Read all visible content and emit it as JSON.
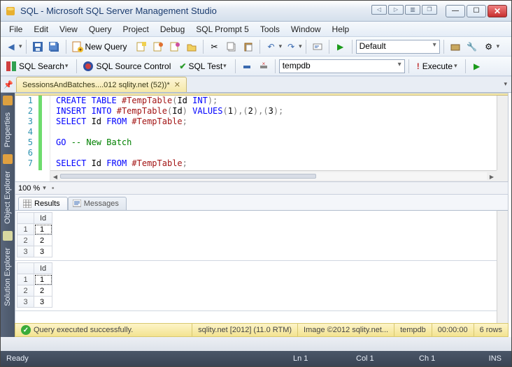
{
  "window": {
    "title": "SQL - Microsoft SQL Server Management Studio"
  },
  "menu": [
    "File",
    "Edit",
    "View",
    "Query",
    "Project",
    "Debug",
    "SQL Prompt 5",
    "Tools",
    "Window",
    "Help"
  ],
  "toolbar1": {
    "newquery_label": "New Query",
    "debug_combo": "Default"
  },
  "toolbar2": {
    "sqlsearch_label": "SQL Search",
    "sqlsource_label": "SQL Source Control",
    "sqltest_label": "SQL Test",
    "db_combo": "tempdb",
    "execute_label": "Execute"
  },
  "doc_tab": {
    "label": "SessionsAndBatches....012 sqlity.net (52))*"
  },
  "sidebar": {
    "tab1": "Properties",
    "tab2": "Object Explorer",
    "tab3": "Solution Explorer"
  },
  "editor": {
    "line_numbers": [
      "1",
      "2",
      "3",
      "4",
      "5",
      "6",
      "7"
    ],
    "lines_html": [
      "<span class='kw'>CREATE</span> <span class='kw'>TABLE</span> <span class='id'>#TempTable</span><span class='op'>(</span>Id <span class='kw'>INT</span><span class='op'>);</span>",
      "<span class='kw'>INSERT</span> <span class='kw'>INTO</span> <span class='id'>#TempTable</span><span class='op'>(</span>Id<span class='op'>)</span> <span class='kw'>VALUES</span><span class='op'>(</span>1<span class='op'>),(</span>2<span class='op'>),(</span>3<span class='op'>);</span>",
      "<span class='kw'>SELECT</span> Id <span class='kw'>FROM</span> <span class='id'>#TempTable</span><span class='op'>;</span>",
      "",
      "<span class='kw'>GO</span> <span class='cm'>-- New Batch</span>",
      "",
      "<span class='kw'>SELECT</span> Id <span class='kw'>FROM</span> <span class='id'>#TempTable</span><span class='op'>;</span>"
    ]
  },
  "zoom": "100 %",
  "results": {
    "tab1": "Results",
    "tab2": "Messages",
    "grids": [
      {
        "header": "Id",
        "rows": [
          [
            1,
            1
          ],
          [
            2,
            2
          ],
          [
            3,
            3
          ]
        ]
      },
      {
        "header": "Id",
        "rows": [
          [
            1,
            1
          ],
          [
            2,
            2
          ],
          [
            3,
            3
          ]
        ]
      }
    ]
  },
  "query_status": {
    "msg": "Query executed successfully.",
    "server": "sqlity.net [2012] (11.0 RTM)",
    "user": "Image ©2012 sqlity.net...",
    "db": "tempdb",
    "time": "00:00:00",
    "rows": "6 rows"
  },
  "app_status": {
    "ready": "Ready",
    "ln": "Ln 1",
    "col": "Col 1",
    "ch": "Ch 1",
    "ins": "INS"
  }
}
